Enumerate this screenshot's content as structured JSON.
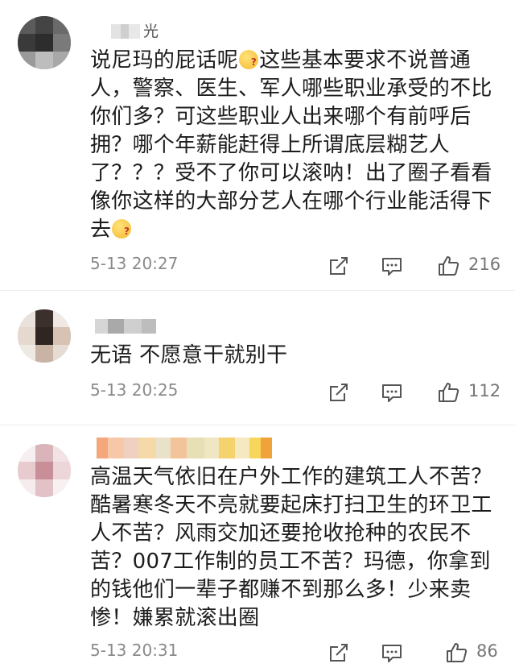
{
  "comments": [
    {
      "name_suffix": "光",
      "text_parts": [
        "说尼玛的屁话呢",
        "这些基本要求不说普通人，警察、医生、军人哪些职业承受的不比你们多？可这些职业人出来哪个有前呼后拥？哪个年薪能赶得上所谓底层糊艺人了？？？受不了你可以滚呐！出了圈子看看像你这样的大部分艺人在哪个行业能活得下去"
      ],
      "time": "5-13 20:27",
      "likes": "216"
    },
    {
      "text": "无语 不愿意干就别干",
      "time": "5-13 20:25",
      "likes": "112"
    },
    {
      "text": "高温天气依旧在户外工作的建筑工人不苦？酷暑寒冬天不亮就要起床打扫卫生的环卫工人不苦？风雨交加还要抢收抢种的农民不苦？007工作制的员工不苦？玛德，你拿到的钱他们一辈子都赚不到那么多！少来卖惨！嫌累就滚出圈",
      "time": "5-13 20:31",
      "likes": "86"
    }
  ],
  "icons": {
    "emoji": "thinking-emoji-icon",
    "share": "share-icon",
    "reply": "comment-icon",
    "like": "thumbs-up-icon"
  },
  "colors": {
    "text": "#1c1c1c",
    "meta": "#8a8a8a",
    "icon": "#555555"
  }
}
